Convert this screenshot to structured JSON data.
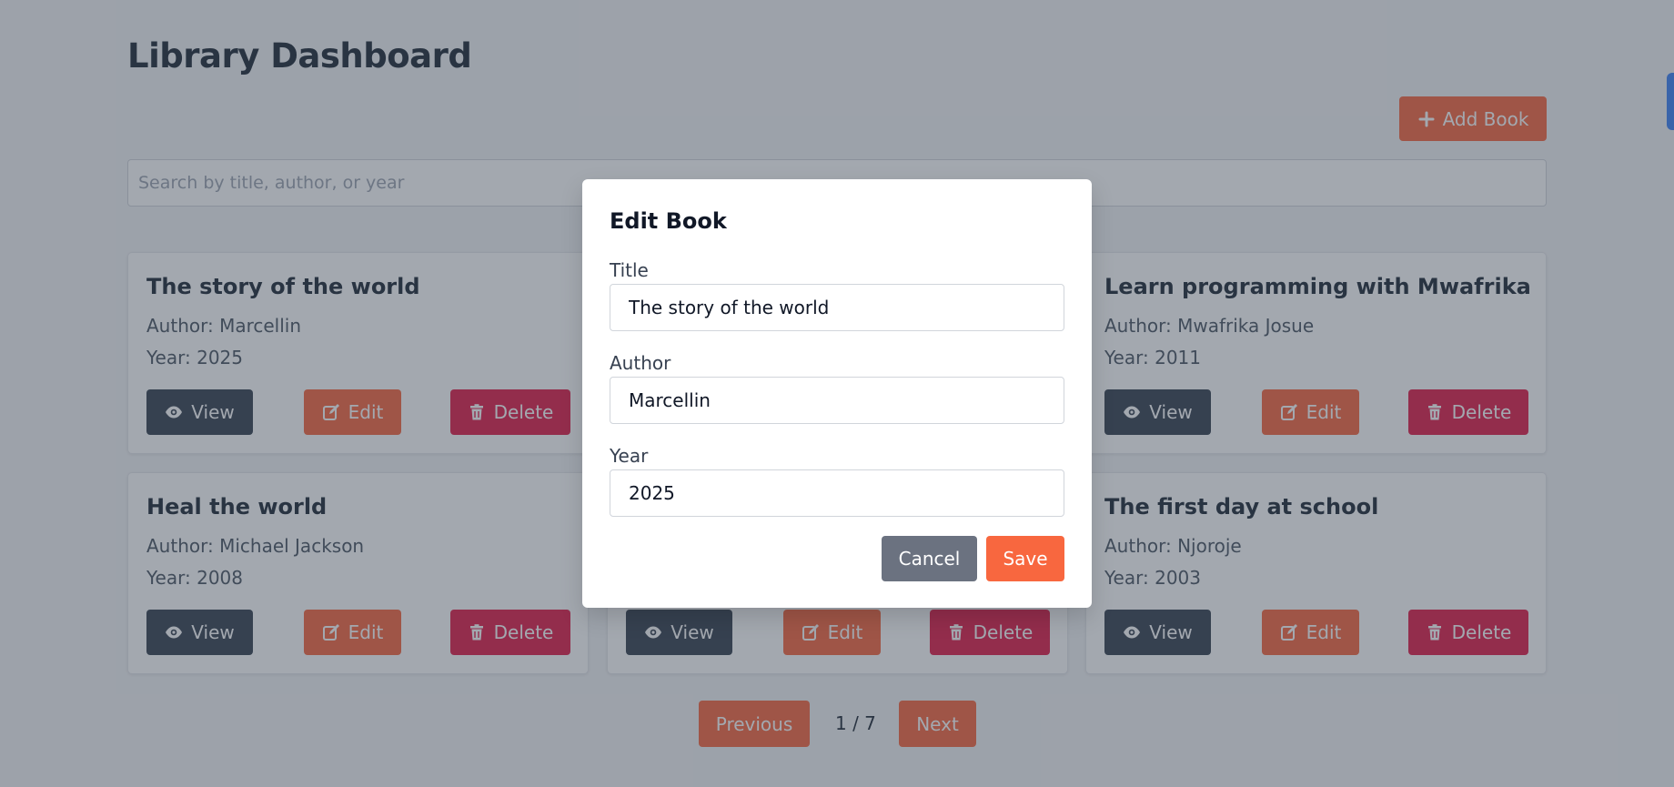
{
  "page_title": "Library Dashboard",
  "add_button": {
    "label": "Add Book",
    "icon": "plus-icon"
  },
  "search": {
    "placeholder": "Search by title, author, or year",
    "value": ""
  },
  "card_buttons": {
    "view": "View",
    "edit": "Edit",
    "delete": "Delete"
  },
  "books": [
    {
      "title": "The story of the world",
      "author": "Author: Marcellin",
      "year": "Year: 2025"
    },
    {
      "title": "",
      "author": "",
      "year": ""
    },
    {
      "title": "Learn programming with Mwafrika",
      "author": "Author: Mwafrika Josue",
      "year": "Year: 2011"
    },
    {
      "title": "Heal the world",
      "author": "Author: Michael Jackson",
      "year": "Year: 2008"
    },
    {
      "title": "",
      "author": "",
      "year": ""
    },
    {
      "title": "The first day at school",
      "author": "Author: Njoroje",
      "year": "Year: 2003"
    }
  ],
  "pagination": {
    "previous": "Previous",
    "info": "1 / 7",
    "next": "Next"
  },
  "modal": {
    "title": "Edit Book",
    "fields": {
      "title": {
        "label": "Title",
        "value": "The story of the world"
      },
      "author": {
        "label": "Author",
        "value": "Marcellin"
      },
      "year": {
        "label": "Year",
        "value": "2025"
      }
    },
    "cancel": "Cancel",
    "save": "Save"
  },
  "colors": {
    "primary": "#f8673f",
    "danger": "#e11d48",
    "dark": "#374151",
    "secondary": "#6b7280",
    "accent_tab": "#3b82f6"
  }
}
